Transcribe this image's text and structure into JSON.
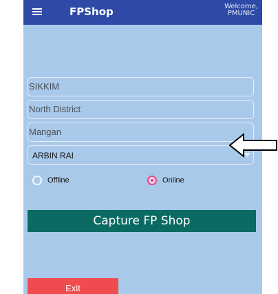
{
  "appbar": {
    "menu_icon": "hamburger-menu-icon",
    "title": "FPShop",
    "welcome_line1": "Welcome,",
    "welcome_line2": "PMUNIC"
  },
  "form": {
    "state": "SIKKIM",
    "district": "North  District",
    "block": "Mangan",
    "selected_name": "ARBIN RAI"
  },
  "mode": {
    "offline_label": "Offline",
    "online_label": "Online",
    "selected": "Online"
  },
  "buttons": {
    "capture_label": "Capture FP Shop",
    "exit_label": "Exit"
  },
  "colors": {
    "appbar": "#2e4aa6",
    "background": "#a9c9ea",
    "capture_button": "#0b6b62",
    "exit_button": "#f04b4e",
    "radio_selected": "#e24a8e"
  }
}
